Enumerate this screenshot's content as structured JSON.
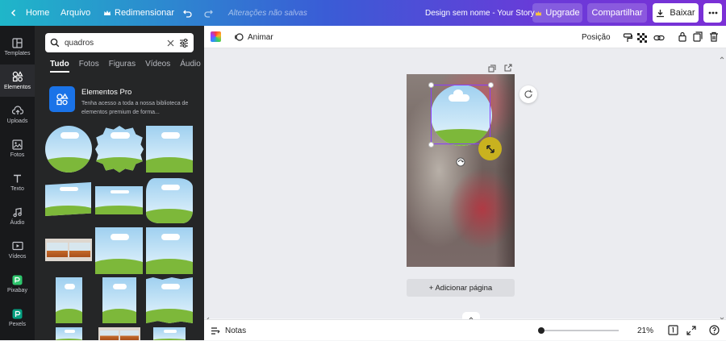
{
  "topbar": {
    "home_label": "Home",
    "arquivo_label": "Arquivo",
    "redimensionar_label": "Redimensionar",
    "unsaved_label": "Alterações não salvas",
    "doc_title": "Design sem nome - Your Story",
    "upgrade_label": "Upgrade",
    "share_label": "Compartilhar",
    "download_label": "Baixar"
  },
  "rail": {
    "items": [
      {
        "label": "Templates",
        "icon": "layout-icon"
      },
      {
        "label": "Elementos",
        "icon": "shapes-icon"
      },
      {
        "label": "Uploads",
        "icon": "cloud-upload-icon"
      },
      {
        "label": "Fotos",
        "icon": "image-icon"
      },
      {
        "label": "Texto",
        "icon": "text-icon"
      },
      {
        "label": "Áudio",
        "icon": "music-icon"
      },
      {
        "label": "Vídeos",
        "icon": "video-icon"
      },
      {
        "label": "Pixabay",
        "icon": "pixabay-icon"
      },
      {
        "label": "Pexels",
        "icon": "pexels-icon"
      }
    ]
  },
  "search": {
    "value": "quadros"
  },
  "tabs": [
    "Tudo",
    "Fotos",
    "Figuras",
    "Vídeos",
    "Áudio"
  ],
  "pro": {
    "title": "Elementos Pro",
    "desc": "Tenha acesso a toda a nossa biblioteca de elementos premium de forma..."
  },
  "toolbar": {
    "animate_label": "Animar",
    "position_label": "Posição"
  },
  "canvas": {
    "add_page_label": "+ Adicionar página"
  },
  "bottombar": {
    "notes_label": "Notas",
    "zoom_label": "21%",
    "zoom_level": 0.21
  },
  "colors": {
    "accent": "#7d2ae8",
    "brand_teal": "#00c4cc",
    "panel": "#252627",
    "rail": "#18191b",
    "selection": "#8b3dff"
  }
}
